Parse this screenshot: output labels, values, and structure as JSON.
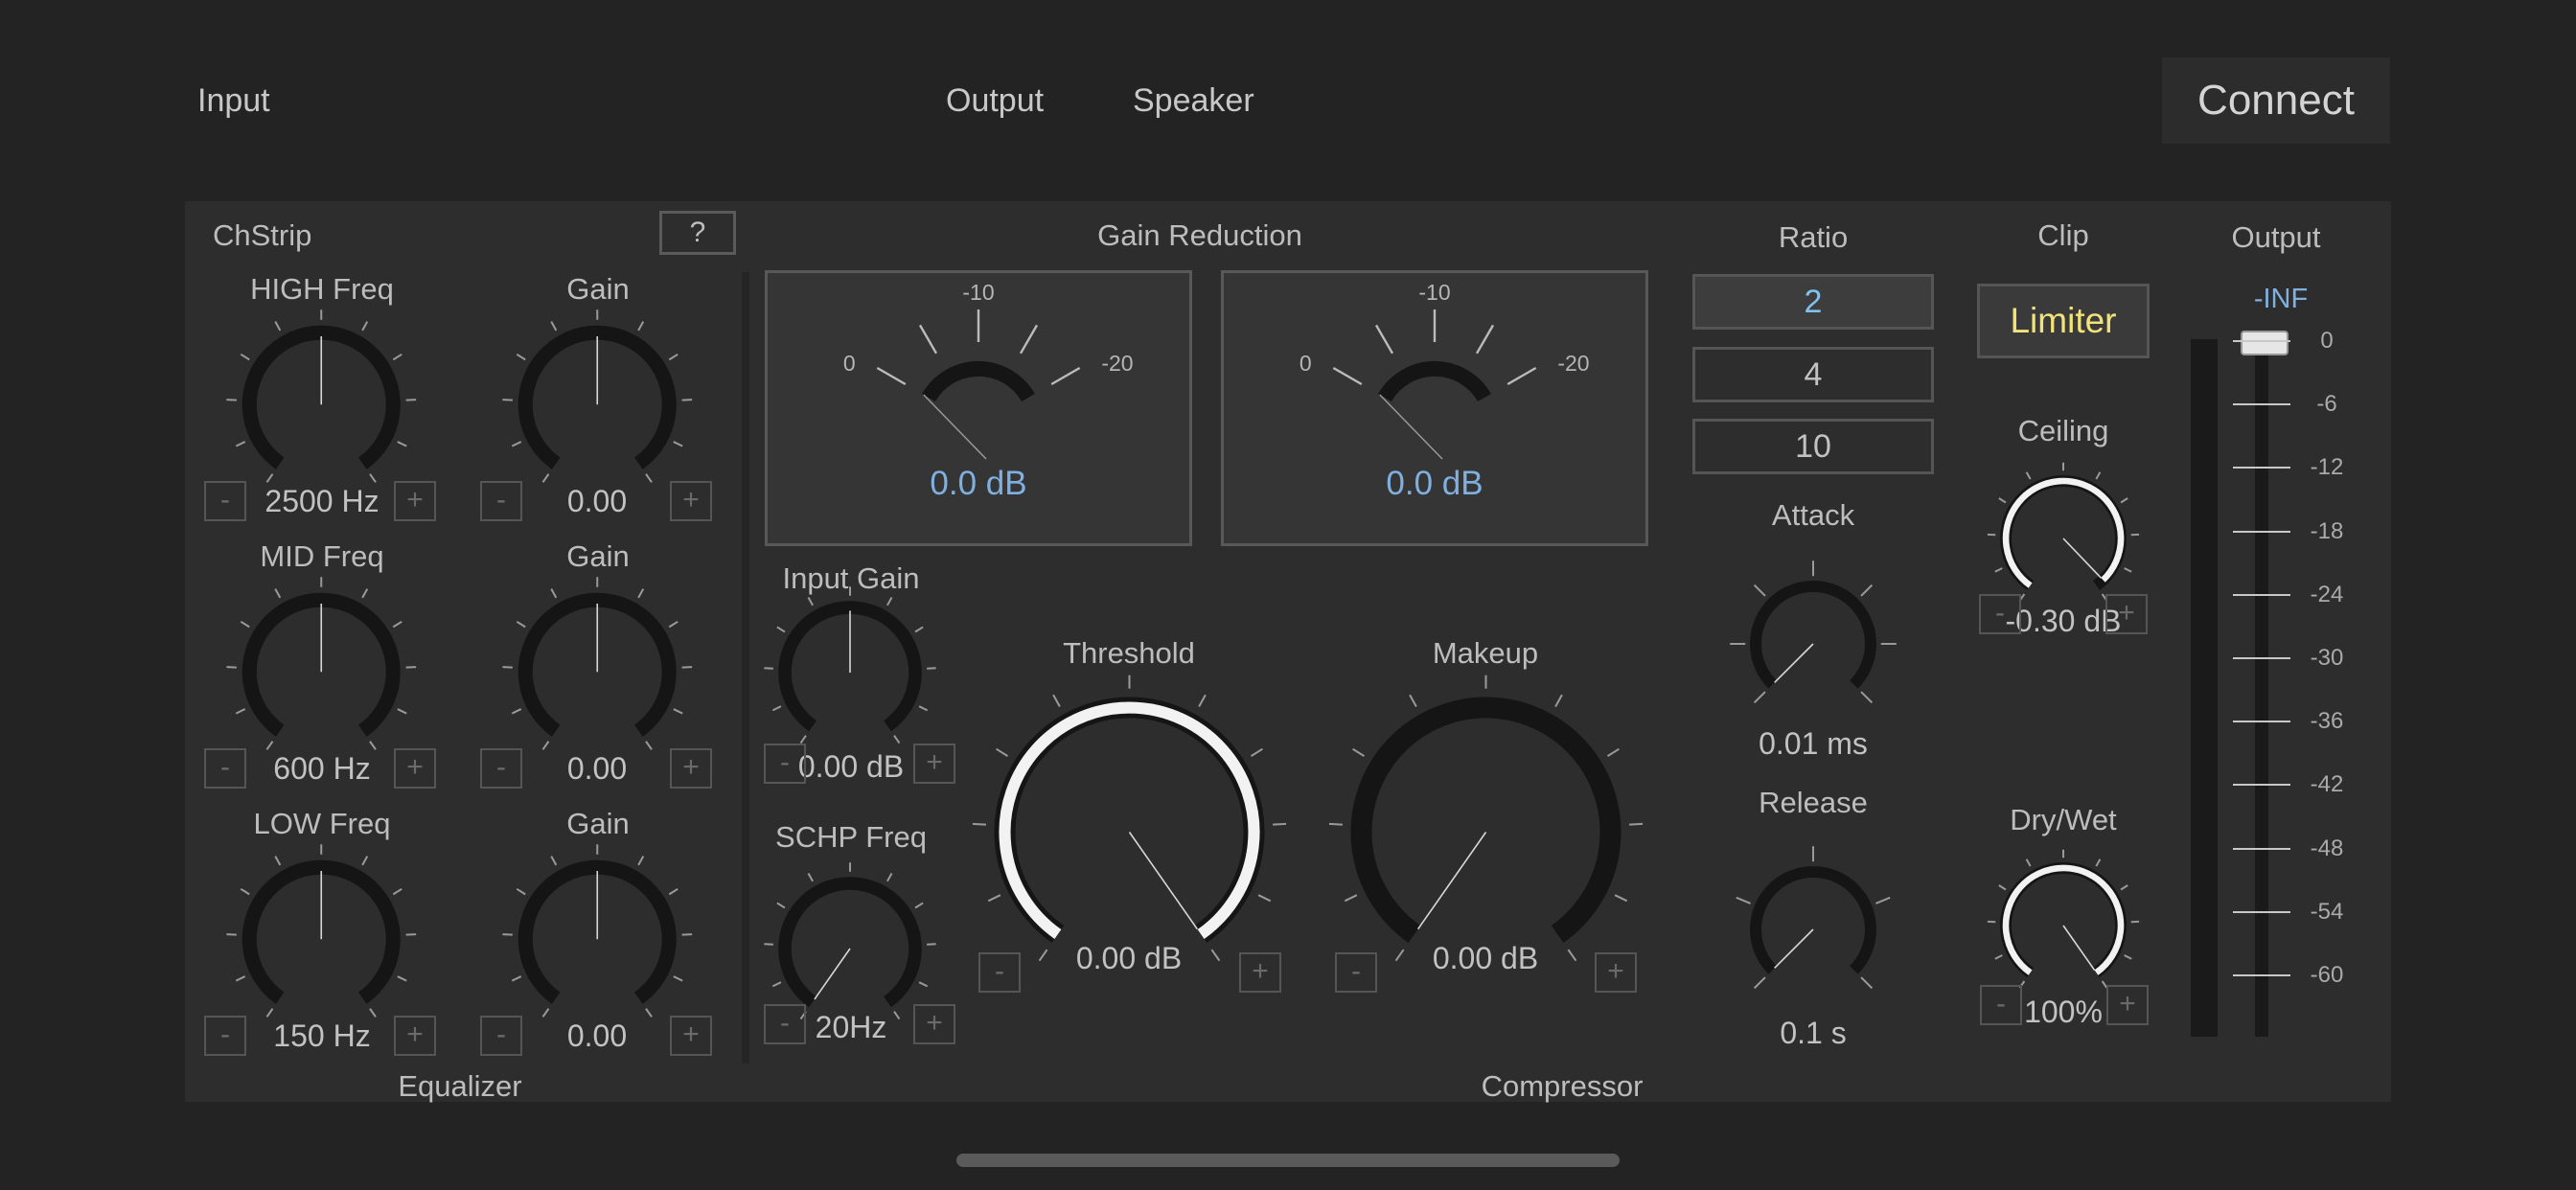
{
  "topbar": {
    "input": "Input",
    "output": "Output",
    "speaker": "Speaker",
    "connect": "Connect"
  },
  "chstrip": {
    "title": "ChStrip",
    "help": "?",
    "equalizer_label": "Equalizer",
    "bands": [
      {
        "freq_label": "HIGH Freq",
        "freq_value": "2500 Hz",
        "freq_level": 0.5,
        "gain_label": "Gain",
        "gain_value": "0.00",
        "gain_level": 0.5
      },
      {
        "freq_label": "MID Freq",
        "freq_value": "600 Hz",
        "freq_level": 0.5,
        "gain_label": "Gain",
        "gain_value": "0.00",
        "gain_level": 0.5
      },
      {
        "freq_label": "LOW Freq",
        "freq_value": "150 Hz",
        "freq_level": 0.5,
        "gain_label": "Gain",
        "gain_value": "0.00",
        "gain_level": 0.5
      }
    ]
  },
  "compressor": {
    "label": "Compressor",
    "gain_reduction_title": "Gain Reduction",
    "meters": [
      {
        "ticks": [
          "0",
          "-10",
          "-20"
        ],
        "value": "0.0 dB"
      },
      {
        "ticks": [
          "0",
          "-10",
          "-20"
        ],
        "value": "0.0 dB"
      }
    ],
    "input_gain": {
      "label": "Input Gain",
      "value": "0.00 dB",
      "level": 0.5
    },
    "schp_freq": {
      "label": "SCHP Freq",
      "value": "20Hz",
      "level": 0.0
    },
    "threshold": {
      "label": "Threshold",
      "value": "0.00 dB",
      "level": 1.0
    },
    "makeup": {
      "label": "Makeup",
      "value": "0.00 dB",
      "level": 0.0
    },
    "ratio": {
      "label": "Ratio",
      "options": [
        "2",
        "4",
        "10"
      ],
      "selected": "2"
    },
    "attack": {
      "label": "Attack",
      "value": "0.01 ms",
      "level": 0.0
    },
    "release": {
      "label": "Release",
      "value": "0.1 s",
      "level": 0.0
    }
  },
  "clip": {
    "label": "Clip",
    "limiter": "Limiter",
    "ceiling": {
      "label": "Ceiling",
      "value": "-0.30 dB",
      "level": 0.97
    },
    "drywet": {
      "label": "Dry/Wet",
      "value": "100%",
      "level": 1.0
    }
  },
  "output": {
    "label": "Output",
    "peak": "-INF",
    "scale": [
      "0",
      "-6",
      "-12",
      "-18",
      "-24",
      "-30",
      "-36",
      "-42",
      "-48",
      "-54",
      "-60"
    ],
    "fader_level": 1.0
  },
  "symbols": {
    "minus": "-",
    "plus": "+"
  },
  "colors": {
    "accent_blue": "#7fb0e0",
    "limiter_yellow": "#f2e27a",
    "panel": "#2d2d2d",
    "background": "#232323"
  }
}
